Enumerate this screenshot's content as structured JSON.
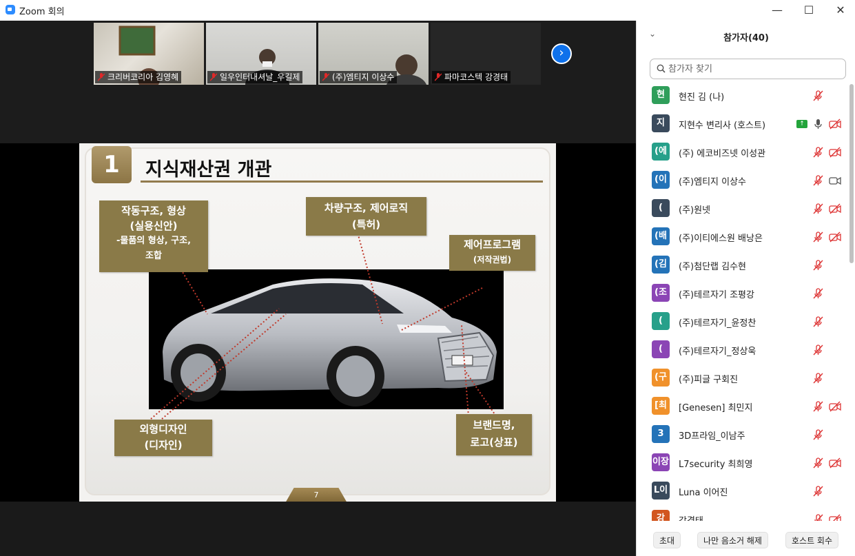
{
  "window": {
    "title": "Zoom 회의",
    "minimize": "—",
    "maximize": "☐",
    "close": "✕"
  },
  "thumbnails": [
    {
      "label": "크리버코리아 김영혜"
    },
    {
      "label": "일우인터내셔날_우길제"
    },
    {
      "label": "(주)엠티지 이상수"
    },
    {
      "label": "파마코스텍 강경태"
    }
  ],
  "strip_next_glyph": "›",
  "slide": {
    "number": "1",
    "title": "지식재산권 개관",
    "boxes": {
      "mechanism": [
        "작동구조, 형상",
        "(실용신안)",
        "-물품의 형상, 구조,",
        "조합"
      ],
      "vehicle": [
        "차량구조, 제어로직",
        "(특허)"
      ],
      "program": [
        "제어프로그램",
        "(저작권법)"
      ],
      "design": [
        "외형디자인",
        "(디자인)"
      ],
      "brand": [
        "브랜드명,",
        "로고(상표)"
      ]
    },
    "page": "7"
  },
  "panel": {
    "title": "참가자(40)",
    "collapse_glyph": "⌄",
    "search_placeholder": "참가자 찾기",
    "participants": [
      {
        "initial": "현",
        "name": "현진 김 (나)",
        "color": "#2f9e5a",
        "muted": true,
        "video": "none",
        "sharing": false
      },
      {
        "initial": "지",
        "name": "지현수 변리사 (호스트)",
        "color": "#3a4a5c",
        "muted": false,
        "video": "off",
        "sharing": true
      },
      {
        "initial": "(에",
        "name": "(주) 에코비즈넷 이성관",
        "color": "#27a08a",
        "muted": true,
        "video": "off",
        "sharing": false
      },
      {
        "initial": "(이",
        "name": "(주)엠티지 이상수",
        "color": "#2473b8",
        "muted": true,
        "video": "on",
        "sharing": false
      },
      {
        "initial": "(",
        "name": "(주)원넷",
        "color": "#3a4a5c",
        "muted": true,
        "video": "off",
        "sharing": false
      },
      {
        "initial": "(배",
        "name": "(주)이티에스원 배낭은",
        "color": "#2473b8",
        "muted": true,
        "video": "off",
        "sharing": false
      },
      {
        "initial": "(김",
        "name": "(주)첨단랩 김수현",
        "color": "#2473b8",
        "muted": true,
        "video": "none",
        "sharing": false
      },
      {
        "initial": "(조",
        "name": "(주)테르자기 조평강",
        "color": "#8b45b5",
        "muted": true,
        "video": "none",
        "sharing": false
      },
      {
        "initial": "(",
        "name": "(주)테르자기_윤정찬",
        "color": "#27a08a",
        "muted": true,
        "video": "none",
        "sharing": false
      },
      {
        "initial": "(",
        "name": "(주)테르자기_정상욱",
        "color": "#8b45b5",
        "muted": true,
        "video": "none",
        "sharing": false
      },
      {
        "initial": "(구",
        "name": "(주)피글 구회진",
        "color": "#f0912b",
        "muted": true,
        "video": "none",
        "sharing": false
      },
      {
        "initial": "[최",
        "name": "[Genesen] 최민지",
        "color": "#f0912b",
        "muted": true,
        "video": "off",
        "sharing": false
      },
      {
        "initial": "3",
        "name": "3D프라임_이남주",
        "color": "#2473b8",
        "muted": true,
        "video": "none",
        "sharing": false
      },
      {
        "initial": "이장",
        "name": "L7security 최희영",
        "color": "#8b45b5",
        "muted": true,
        "video": "off",
        "sharing": false
      },
      {
        "initial": "L이",
        "name": "Luna 이어진",
        "color": "#3a4a5c",
        "muted": true,
        "video": "none",
        "sharing": false
      },
      {
        "initial": "강",
        "name": "강경태",
        "color": "#d2561f",
        "muted": true,
        "video": "off",
        "sharing": false
      }
    ],
    "footer": {
      "invite": "초대",
      "unmute_me": "나만 음소거 해제",
      "host_recall": "호스트 회수"
    }
  }
}
